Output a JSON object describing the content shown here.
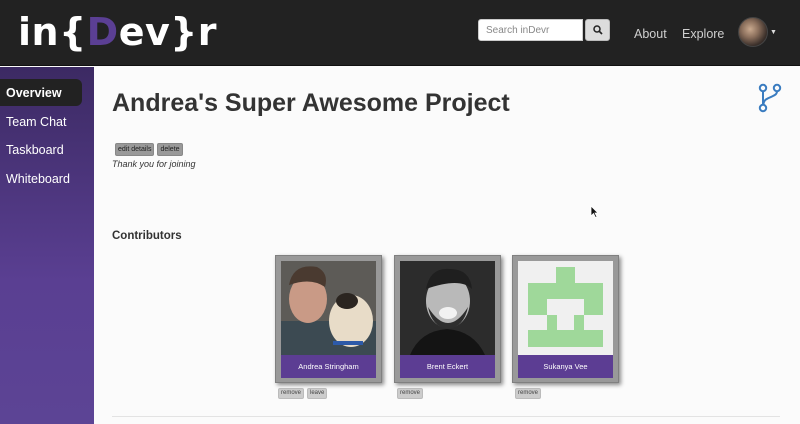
{
  "header": {
    "logo": {
      "prefix": "in{",
      "accent": "D",
      "suffix": "ev}r"
    },
    "search_placeholder": "Search inDevr",
    "nav": {
      "about": "About",
      "explore": "Explore"
    }
  },
  "sidebar": {
    "items": [
      {
        "label": "Overview",
        "active": true
      },
      {
        "label": "Team Chat"
      },
      {
        "label": "Taskboard"
      },
      {
        "label": "Whiteboard"
      }
    ]
  },
  "project": {
    "title": "Andrea's Super Awesome Project",
    "buttons": {
      "edit": "edit details",
      "delete": "delete"
    },
    "description": "Thank you for joining",
    "contributors_heading": "Contributors"
  },
  "contributors": [
    {
      "name": "Andrea Stringham",
      "actions": [
        "remove",
        "leave"
      ]
    },
    {
      "name": "Brent Eckert",
      "actions": [
        "remove"
      ]
    },
    {
      "name": "Sukanya Vee",
      "actions": [
        "remove"
      ]
    }
  ],
  "colors": {
    "accent": "#5c3d93",
    "header_bg": "#222222",
    "identicon_green": "#9fd89a"
  },
  "icons": {
    "fork": "git-fork-icon",
    "search": "search-icon"
  }
}
